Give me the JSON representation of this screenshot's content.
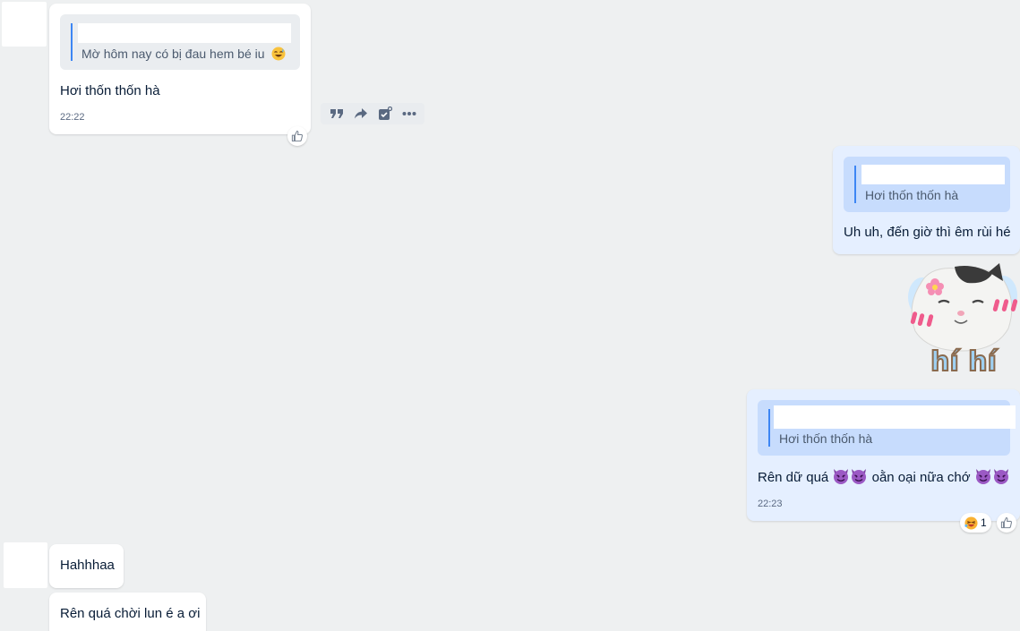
{
  "messages": [
    {
      "quote_text": "Mờ hôm nay có bị đau hem bé iu",
      "text": "Hơi thốn thốn hà",
      "time": "22:22"
    },
    {
      "quote_text": "Hơi thốn thốn hà",
      "text": "Uh uh, đến giờ thì êm rùi hé"
    },
    {
      "sticker_text": "hí hí"
    },
    {
      "quote_text": "Hơi thốn thốn hà",
      "text_part1": "Rên dữ quá",
      "text_part2": "oằn oại nữa chớ",
      "time": "22:23",
      "reaction_count": "1"
    },
    {
      "text": "Hahhhaa"
    },
    {
      "text": "Rên quá chời lun é a ơi"
    }
  ],
  "icons": {
    "toolbar": [
      "quote-icon",
      "share-icon",
      "task-icon",
      "more-icon"
    ],
    "reaction": "thumbs-up-icon",
    "reaction_emoji": "laughing-face-icon",
    "inline_emoji": "smiling-devil-icon",
    "quote_emoji": "laughing-sweat-icon"
  },
  "colors": {
    "background": "#eef0f1",
    "incoming_bubble": "#ffffff",
    "outgoing_bubble": "#e5efff",
    "quote_bar": "#3d86f4"
  }
}
